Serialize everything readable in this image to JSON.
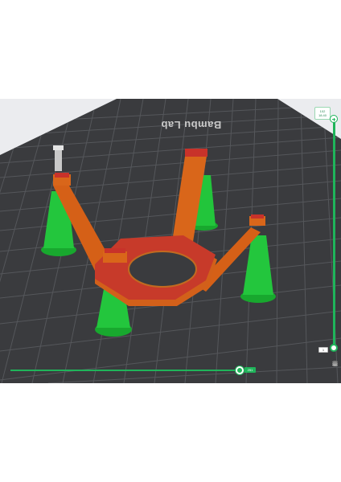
{
  "plate": {
    "brand_text": "Bambu Lab"
  },
  "layer_slider": {
    "top_layer": "102",
    "top_height": "18.40",
    "bottom_layer": "1"
  },
  "move_slider": {
    "value": "251"
  },
  "colors": {
    "plate": "#3b3c3f",
    "grid": "#5a5b5f",
    "support": "#1fc43a",
    "model": "#d86518",
    "model_top": "#c8322a",
    "accent": "#1fb45a"
  },
  "icons": {
    "stack": "layers-icon",
    "add": "plus-icon"
  }
}
